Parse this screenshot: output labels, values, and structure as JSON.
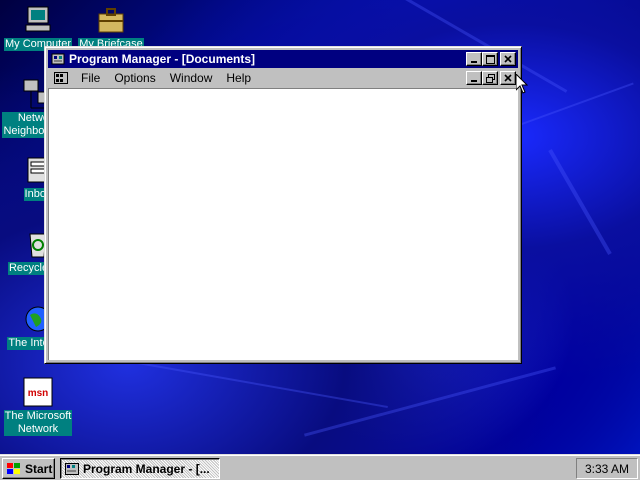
{
  "desktop": {
    "icons": [
      {
        "label": "My Computer",
        "icon": "my-computer-icon"
      },
      {
        "label": "My Briefcase",
        "icon": "briefcase-icon"
      },
      {
        "label": "Network\nNeighborhood",
        "icon": "network-neighborhood-icon"
      },
      {
        "label": "Inbox",
        "icon": "inbox-icon"
      },
      {
        "label": "Recycle Bin",
        "icon": "recycle-bin-icon"
      },
      {
        "label": "The Internet",
        "icon": "internet-icon"
      },
      {
        "label": "The Microsoft\nNetwork",
        "icon": "msn-icon"
      }
    ],
    "wallpaper_color": "#0010c0",
    "icon_label_bg": "#008080"
  },
  "window": {
    "title": "Program Manager - [Documents]",
    "title_color": "#000080",
    "menu": [
      {
        "label": "File"
      },
      {
        "label": "Options"
      },
      {
        "label": "Window"
      },
      {
        "label": "Help"
      }
    ]
  },
  "taskbar": {
    "start_label": "Start",
    "task_label": "Program Manager - [...",
    "clock": "3:33 AM"
  }
}
